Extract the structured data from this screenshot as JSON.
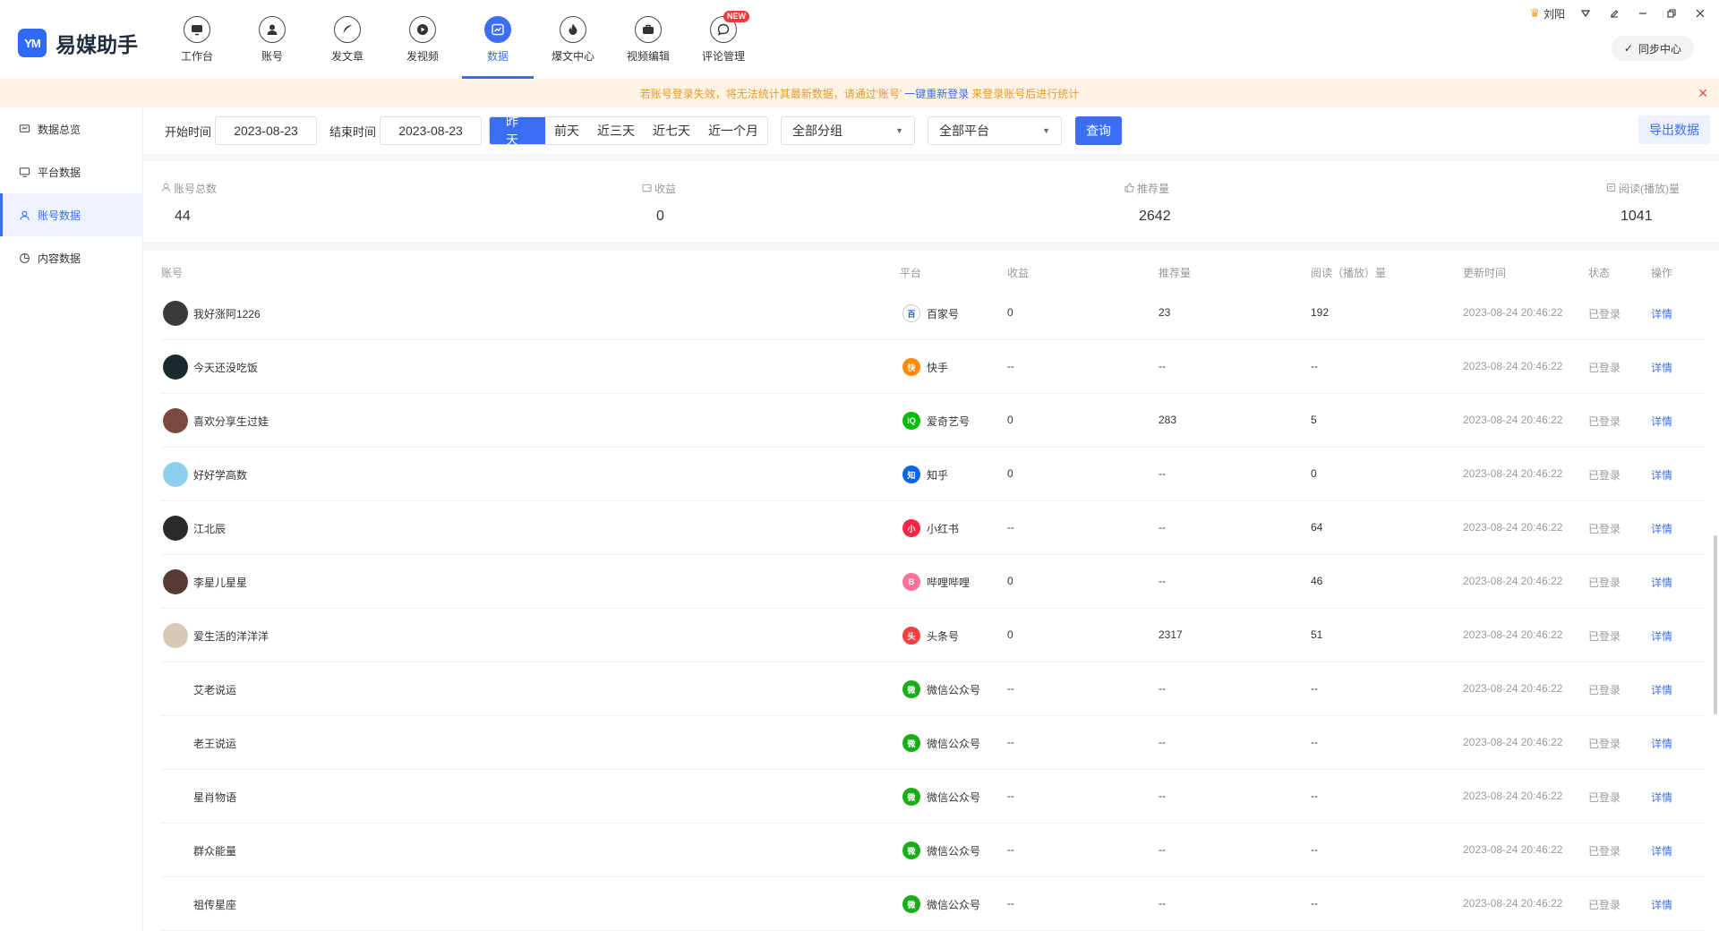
{
  "app": {
    "logo_mark": "YM",
    "name": "易媒助手"
  },
  "nav": [
    {
      "label": "工作台",
      "icon": "monitor-icon",
      "active": false,
      "new": false
    },
    {
      "label": "账号",
      "icon": "user-icon",
      "active": false,
      "new": false
    },
    {
      "label": "发文章",
      "icon": "feather-icon",
      "active": false,
      "new": false
    },
    {
      "label": "发视频",
      "icon": "play-icon",
      "active": false,
      "new": false
    },
    {
      "label": "数据",
      "icon": "chart-icon",
      "active": true,
      "new": false
    },
    {
      "label": "爆文中心",
      "icon": "fire-icon",
      "active": false,
      "new": false
    },
    {
      "label": "视频编辑",
      "icon": "briefcase-icon",
      "active": false,
      "new": false
    },
    {
      "label": "评论管理",
      "icon": "comment-icon",
      "active": false,
      "new": true
    }
  ],
  "new_badge": "NEW",
  "user": {
    "name": "刘阳"
  },
  "sync_label": "同步中心",
  "notice": {
    "text_before": "若账号登录失效，将无法统计其最新数据，请通过'账号'",
    "link": "一键重新登录",
    "text_after": "来登录账号后进行统计"
  },
  "sidebar": [
    {
      "label": "数据总览",
      "icon": "overview-icon",
      "active": false
    },
    {
      "label": "平台数据",
      "icon": "monitor-icon",
      "active": false
    },
    {
      "label": "账号数据",
      "icon": "user-icon",
      "active": true
    },
    {
      "label": "内容数据",
      "icon": "pie-icon",
      "active": false
    }
  ],
  "filter": {
    "start_label": "开始时间",
    "start_date": "2023-08-23",
    "end_label": "结束时间",
    "end_date": "2023-08-23",
    "quick": [
      "昨天",
      "前天",
      "近三天",
      "近七天",
      "近一个月"
    ],
    "quick_selected": "昨天",
    "group": "全部分组",
    "platform": "全部平台",
    "query": "查询",
    "export": "导出数据"
  },
  "stats": [
    {
      "label": "账号总数",
      "value": "44",
      "icon": "user-icon"
    },
    {
      "label": "收益",
      "value": "0",
      "icon": "wallet-icon"
    },
    {
      "label": "推荐量",
      "value": "2642",
      "icon": "thumb-icon"
    },
    {
      "label": "阅读(播放)量",
      "value": "1041",
      "icon": "read-icon"
    }
  ],
  "table": {
    "headers": [
      "账号",
      "平台",
      "收益",
      "推荐量",
      "阅读（播放）量",
      "更新时间",
      "状态",
      "操作"
    ],
    "rows": [
      {
        "account": "我好涨阿1226",
        "platform": "百家号",
        "revenue": "0",
        "recommend": "23",
        "reads": "192",
        "updated": "2023-08-24 20:46:22",
        "status": "已登录",
        "action": "详情",
        "avatar": "#3a3a3a",
        "plat_color": "#ffffff",
        "plat_glyph": "百"
      },
      {
        "account": "今天还没吃饭",
        "platform": "快手",
        "revenue": "--",
        "recommend": "--",
        "reads": "--",
        "updated": "2023-08-24 20:46:22",
        "status": "已登录",
        "action": "详情",
        "avatar": "#1c2a2e",
        "plat_color": "#ff8a00",
        "plat_glyph": "快"
      },
      {
        "account": "喜欢分享生过娃",
        "platform": "爱奇艺号",
        "revenue": "0",
        "recommend": "283",
        "reads": "5",
        "updated": "2023-08-24 20:46:22",
        "status": "已登录",
        "action": "详情",
        "avatar": "#7a4a3c",
        "plat_color": "#00be06",
        "plat_glyph": "iQ"
      },
      {
        "account": "好好学高数",
        "platform": "知乎",
        "revenue": "0",
        "recommend": "--",
        "reads": "0",
        "updated": "2023-08-24 20:46:22",
        "status": "已登录",
        "action": "详情",
        "avatar": "#8ecff0",
        "plat_color": "#0a66e6",
        "plat_glyph": "知"
      },
      {
        "account": "江北辰",
        "platform": "小红书",
        "revenue": "--",
        "recommend": "--",
        "reads": "64",
        "updated": "2023-08-24 20:46:22",
        "status": "已登录",
        "action": "详情",
        "avatar": "#2b2b2b",
        "plat_color": "#ff2442",
        "plat_glyph": "小"
      },
      {
        "account": "李星儿星星",
        "platform": "哔哩哔哩",
        "revenue": "0",
        "recommend": "--",
        "reads": "46",
        "updated": "2023-08-24 20:46:22",
        "status": "已登录",
        "action": "详情",
        "avatar": "#5a3a36",
        "plat_color": "#fb7299",
        "plat_glyph": "B"
      },
      {
        "account": "爱生活的洋洋洋",
        "platform": "头条号",
        "revenue": "0",
        "recommend": "2317",
        "reads": "51",
        "updated": "2023-08-24 20:46:22",
        "status": "已登录",
        "action": "详情",
        "avatar": "#d9c8b4",
        "plat_color": "#f04142",
        "plat_glyph": "头"
      },
      {
        "account": "艾老说运",
        "platform": "微信公众号",
        "revenue": "--",
        "recommend": "--",
        "reads": "--",
        "updated": "2023-08-24 20:46:22",
        "status": "已登录",
        "action": "详情",
        "avatar": "",
        "plat_color": "#1aad19",
        "plat_glyph": "微"
      },
      {
        "account": "老王说运",
        "platform": "微信公众号",
        "revenue": "--",
        "recommend": "--",
        "reads": "--",
        "updated": "2023-08-24 20:46:22",
        "status": "已登录",
        "action": "详情",
        "avatar": "",
        "plat_color": "#1aad19",
        "plat_glyph": "微"
      },
      {
        "account": "星肖物语",
        "platform": "微信公众号",
        "revenue": "--",
        "recommend": "--",
        "reads": "--",
        "updated": "2023-08-24 20:46:22",
        "status": "已登录",
        "action": "详情",
        "avatar": "",
        "plat_color": "#1aad19",
        "plat_glyph": "微"
      },
      {
        "account": "群众能量",
        "platform": "微信公众号",
        "revenue": "--",
        "recommend": "--",
        "reads": "--",
        "updated": "2023-08-24 20:46:22",
        "status": "已登录",
        "action": "详情",
        "avatar": "",
        "plat_color": "#1aad19",
        "plat_glyph": "微"
      },
      {
        "account": "祖传星座",
        "platform": "微信公众号",
        "revenue": "--",
        "recommend": "--",
        "reads": "--",
        "updated": "2023-08-24 20:46:22",
        "status": "已登录",
        "action": "详情",
        "avatar": "",
        "plat_color": "#1aad19",
        "plat_glyph": "微"
      }
    ]
  },
  "colors": {
    "accent": "#3b6ef5",
    "notice_text": "#e89a2f",
    "notice_bg": "#fdf3e4"
  }
}
